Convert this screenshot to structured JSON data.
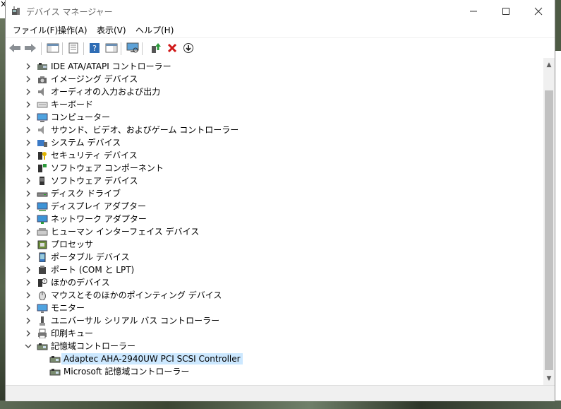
{
  "window": {
    "title": "デバイス マネージャー",
    "controls": {
      "minimize": "—",
      "maximize": "☐",
      "close": "✕"
    }
  },
  "menu": [
    "ファイル(F)",
    "操作(A)",
    "表示(V)",
    "ヘルプ(H)"
  ],
  "toolbar": [
    {
      "icon": "back-arrow-icon"
    },
    {
      "icon": "forward-arrow-icon"
    },
    {
      "icon": "show-hide-console-tree-icon"
    },
    {
      "icon": "properties-icon"
    },
    {
      "icon": "help-icon"
    },
    {
      "icon": "action-pane-icon"
    },
    {
      "icon": "scan-hardware-icon"
    },
    {
      "icon": "update-driver-icon"
    },
    {
      "icon": "uninstall-device-icon"
    },
    {
      "icon": "download-driver-icon"
    }
  ],
  "tree": [
    {
      "label": "IDE ATA/ATAPI コントローラー",
      "icon": "ide-controller-icon",
      "expanded": false,
      "level": 0
    },
    {
      "label": "イメージング デバイス",
      "icon": "camera-icon",
      "expanded": false,
      "level": 0
    },
    {
      "label": "オーディオの入力および出力",
      "icon": "speaker-icon",
      "expanded": false,
      "level": 0
    },
    {
      "label": "キーボード",
      "icon": "keyboard-icon",
      "expanded": false,
      "level": 0
    },
    {
      "label": "コンピューター",
      "icon": "computer-icon",
      "expanded": false,
      "level": 0
    },
    {
      "label": "サウンド、ビデオ、およびゲーム コントローラー",
      "icon": "sound-icon",
      "expanded": false,
      "level": 0
    },
    {
      "label": "システム デバイス",
      "icon": "system-device-icon",
      "expanded": false,
      "level": 0
    },
    {
      "label": "セキュリティ デバイス",
      "icon": "security-key-icon",
      "expanded": false,
      "level": 0
    },
    {
      "label": "ソフトウェア コンポーネント",
      "icon": "software-component-icon",
      "expanded": false,
      "level": 0
    },
    {
      "label": "ソフトウェア デバイス",
      "icon": "software-device-icon",
      "expanded": false,
      "level": 0
    },
    {
      "label": "ディスク ドライブ",
      "icon": "disk-drive-icon",
      "expanded": false,
      "level": 0
    },
    {
      "label": "ディスプレイ アダプター",
      "icon": "display-adapter-icon",
      "expanded": false,
      "level": 0
    },
    {
      "label": "ネットワーク アダプター",
      "icon": "network-adapter-icon",
      "expanded": false,
      "level": 0
    },
    {
      "label": "ヒューマン インターフェイス デバイス",
      "icon": "hid-icon",
      "expanded": false,
      "level": 0
    },
    {
      "label": "プロセッサ",
      "icon": "processor-icon",
      "expanded": false,
      "level": 0
    },
    {
      "label": "ポータブル デバイス",
      "icon": "portable-device-icon",
      "expanded": false,
      "level": 0
    },
    {
      "label": "ポート (COM と LPT)",
      "icon": "port-icon",
      "expanded": false,
      "level": 0
    },
    {
      "label": "ほかのデバイス",
      "icon": "unknown-device-icon",
      "expanded": false,
      "level": 0
    },
    {
      "label": "マウスとそのほかのポインティング デバイス",
      "icon": "mouse-icon",
      "expanded": false,
      "level": 0
    },
    {
      "label": "モニター",
      "icon": "monitor-icon",
      "expanded": false,
      "level": 0
    },
    {
      "label": "ユニバーサル シリアル バス コントローラー",
      "icon": "usb-icon",
      "expanded": false,
      "level": 0
    },
    {
      "label": "印刷キュー",
      "icon": "printer-icon",
      "expanded": false,
      "level": 0
    },
    {
      "label": "記憶域コントローラー",
      "icon": "storage-controller-icon",
      "expanded": true,
      "level": 0
    },
    {
      "label": "Adaptec AHA-2940UW PCI SCSI Controller",
      "icon": "storage-controller-icon",
      "level": 1,
      "selected": true
    },
    {
      "label": "Microsoft 記憶域コントローラー",
      "icon": "storage-controller-icon",
      "level": 1
    }
  ]
}
